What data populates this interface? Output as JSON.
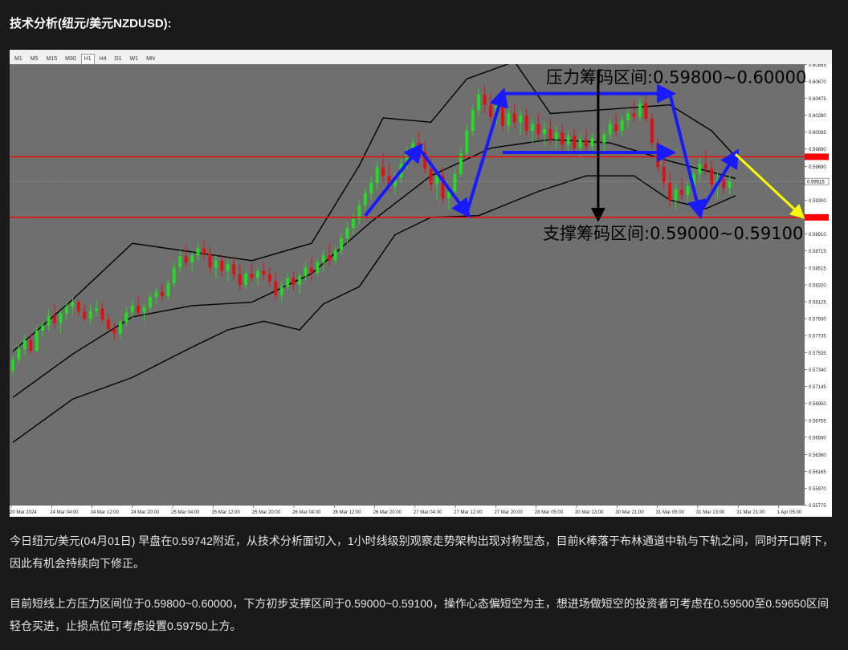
{
  "article": {
    "title": "技术分析(纽元/美元NZDUSD):",
    "paragraph1": "今日纽元/美元(04月01日) 早盘在0.59742附近，从技术分析面切入，1小时线级别观察走势架构出现对称型态，目前K棒落于布林通道中轨与下轨之间，同时开口朝下，因此有机会持续向下修正。",
    "paragraph2": "目前短线上方压力区间位于0.59800~0.60000，下方初步支撑区间于0.59000~0.59100，操作心态偏短空为主，想进场做短空的投资者可考虑在0.59500至0.59650区间轻仓买进，止损点位可考虑设置0.59750上方。"
  },
  "timeframes": [
    "M1",
    "M5",
    "M15",
    "M30",
    "H1",
    "H4",
    "D1",
    "W1",
    "MN"
  ],
  "active_timeframe": "H1",
  "chart_data": {
    "type": "candlestick",
    "symbol": "NZDUSD",
    "timeframe": "H1",
    "ylim": [
      0.5577,
      0.6087
    ],
    "y_ticks": [
      "0.60865",
      "0.60670",
      "0.60475",
      "0.60280",
      "0.60085",
      "0.59890",
      "0.59690",
      "0.59515",
      "0.59300",
      "0.59105",
      "0.58910",
      "0.58715",
      "0.58515",
      "0.58320",
      "0.58125",
      "0.57930",
      "0.57735",
      "0.57535",
      "0.57340",
      "0.57145",
      "0.56950",
      "0.56755",
      "0.56560",
      "0.56360",
      "0.56165",
      "0.55970",
      "0.55775"
    ],
    "x_ticks": [
      "20 Mar 2024",
      "24 Mar 04:00",
      "24 Mar 12:00",
      "24 Mar 20:00",
      "25 Mar 04:00",
      "25 Mar 12:00",
      "25 Mar 20:00",
      "26 Mar 04:00",
      "26 Mar 12:00",
      "26 Mar 20:00",
      "27 Mar 04:00",
      "27 Mar 12:00",
      "27 Mar 20:00",
      "28 Mar 05:00",
      "30 Mar 13:00",
      "30 Mar 21:00",
      "31 Mar 05:00",
      "31 Mar 13:00",
      "31 Mar 21:00",
      "1 Apr 05:00"
    ],
    "current_price_tag": "0.59515",
    "resistance_line": 0.598,
    "support_line": 0.591,
    "resistance_label": "压力筹码区间:0.59800~0.60000",
    "support_label": "支撑筹码区间:0.59000~0.59100",
    "colors": {
      "background": "#6f6f6f",
      "bull": "#22dd22",
      "bear": "#e01010",
      "band": "#000000",
      "level": "#ff0000",
      "pattern": "#1a1aff",
      "forecast": "#ffff00"
    },
    "candles": [
      [
        0.5733,
        0.575,
        0.5728,
        0.5746
      ],
      [
        0.5746,
        0.5764,
        0.5741,
        0.5758
      ],
      [
        0.5758,
        0.5774,
        0.5751,
        0.5768
      ],
      [
        0.5768,
        0.5775,
        0.5752,
        0.5756
      ],
      [
        0.5756,
        0.5784,
        0.5754,
        0.5779
      ],
      [
        0.5779,
        0.579,
        0.5772,
        0.5785
      ],
      [
        0.5785,
        0.5804,
        0.5779,
        0.5796
      ],
      [
        0.5796,
        0.581,
        0.5782,
        0.5788
      ],
      [
        0.5788,
        0.5802,
        0.5776,
        0.5799
      ],
      [
        0.5799,
        0.5813,
        0.579,
        0.5807
      ],
      [
        0.5807,
        0.5818,
        0.5799,
        0.5812
      ],
      [
        0.5812,
        0.5815,
        0.5796,
        0.5801
      ],
      [
        0.5801,
        0.5809,
        0.579,
        0.5793
      ],
      [
        0.5793,
        0.5809,
        0.5787,
        0.5802
      ],
      [
        0.5802,
        0.5814,
        0.5796,
        0.5805
      ],
      [
        0.5805,
        0.5811,
        0.5788,
        0.5792
      ],
      [
        0.5792,
        0.5797,
        0.5778,
        0.5781
      ],
      [
        0.5781,
        0.5788,
        0.5768,
        0.5776
      ],
      [
        0.5776,
        0.5792,
        0.577,
        0.5789
      ],
      [
        0.5789,
        0.5806,
        0.5784,
        0.58
      ],
      [
        0.58,
        0.5815,
        0.5794,
        0.5808
      ],
      [
        0.5808,
        0.582,
        0.5796,
        0.58
      ],
      [
        0.58,
        0.581,
        0.579,
        0.5806
      ],
      [
        0.5806,
        0.5822,
        0.5802,
        0.5818
      ],
      [
        0.5818,
        0.5829,
        0.581,
        0.5824
      ],
      [
        0.5824,
        0.5833,
        0.5814,
        0.5819
      ],
      [
        0.5819,
        0.5838,
        0.5815,
        0.5834
      ],
      [
        0.5834,
        0.5858,
        0.583,
        0.5852
      ],
      [
        0.5852,
        0.5872,
        0.5846,
        0.5865
      ],
      [
        0.5865,
        0.5878,
        0.5852,
        0.5858
      ],
      [
        0.5858,
        0.587,
        0.5848,
        0.5866
      ],
      [
        0.5866,
        0.588,
        0.586,
        0.5874
      ],
      [
        0.5874,
        0.5885,
        0.5862,
        0.5868
      ],
      [
        0.5868,
        0.5876,
        0.5845,
        0.5852
      ],
      [
        0.5852,
        0.5866,
        0.584,
        0.586
      ],
      [
        0.586,
        0.5868,
        0.5842,
        0.5848
      ],
      [
        0.5848,
        0.5862,
        0.5836,
        0.5856
      ],
      [
        0.5856,
        0.5865,
        0.5838,
        0.5844
      ],
      [
        0.5844,
        0.5856,
        0.5826,
        0.5832
      ],
      [
        0.5832,
        0.5848,
        0.5828,
        0.5845
      ],
      [
        0.5845,
        0.5856,
        0.5836,
        0.584
      ],
      [
        0.584,
        0.5852,
        0.5832,
        0.5848
      ],
      [
        0.5848,
        0.5858,
        0.5838,
        0.5844
      ],
      [
        0.5844,
        0.5852,
        0.583,
        0.5836
      ],
      [
        0.5836,
        0.5846,
        0.5814,
        0.582
      ],
      [
        0.582,
        0.5836,
        0.5812,
        0.583
      ],
      [
        0.583,
        0.5845,
        0.5826,
        0.584
      ],
      [
        0.584,
        0.5848,
        0.5826,
        0.5832
      ],
      [
        0.5832,
        0.5846,
        0.5822,
        0.5842
      ],
      [
        0.5842,
        0.5858,
        0.5836,
        0.5852
      ],
      [
        0.5852,
        0.5864,
        0.5838,
        0.5846
      ],
      [
        0.5846,
        0.5862,
        0.5842,
        0.5858
      ],
      [
        0.5858,
        0.5872,
        0.5848,
        0.5866
      ],
      [
        0.5866,
        0.588,
        0.5854,
        0.586
      ],
      [
        0.586,
        0.5876,
        0.5856,
        0.5872
      ],
      [
        0.5872,
        0.5892,
        0.5866,
        0.5886
      ],
      [
        0.5886,
        0.5904,
        0.588,
        0.5898
      ],
      [
        0.5898,
        0.5915,
        0.589,
        0.5908
      ],
      [
        0.5908,
        0.593,
        0.5902,
        0.5924
      ],
      [
        0.5924,
        0.5945,
        0.5918,
        0.5938
      ],
      [
        0.5938,
        0.5958,
        0.593,
        0.595
      ],
      [
        0.595,
        0.5975,
        0.5942,
        0.5968
      ],
      [
        0.5968,
        0.5984,
        0.595,
        0.5958
      ],
      [
        0.5958,
        0.5972,
        0.594,
        0.5946
      ],
      [
        0.5946,
        0.5962,
        0.5936,
        0.5956
      ],
      [
        0.5956,
        0.5978,
        0.595,
        0.5972
      ],
      [
        0.5972,
        0.5992,
        0.5966,
        0.5986
      ],
      [
        0.5986,
        0.6002,
        0.5976,
        0.5996
      ],
      [
        0.5996,
        0.601,
        0.598,
        0.5986
      ],
      [
        0.5986,
        0.5998,
        0.596,
        0.5966
      ],
      [
        0.5966,
        0.5978,
        0.594,
        0.5948
      ],
      [
        0.5948,
        0.5962,
        0.593,
        0.5958
      ],
      [
        0.5958,
        0.5968,
        0.5926,
        0.5932
      ],
      [
        0.5932,
        0.5946,
        0.5918,
        0.594
      ],
      [
        0.594,
        0.5966,
        0.5936,
        0.596
      ],
      [
        0.596,
        0.599,
        0.5956,
        0.5984
      ],
      [
        0.5984,
        0.6016,
        0.5978,
        0.601
      ],
      [
        0.601,
        0.604,
        0.6004,
        0.6034
      ],
      [
        0.6034,
        0.606,
        0.6026,
        0.6052
      ],
      [
        0.6052,
        0.6062,
        0.603,
        0.604
      ],
      [
        0.604,
        0.6054,
        0.602,
        0.6026
      ],
      [
        0.6026,
        0.6046,
        0.6018,
        0.604
      ],
      [
        0.604,
        0.605,
        0.601,
        0.6016
      ],
      [
        0.6016,
        0.6036,
        0.6008,
        0.603
      ],
      [
        0.603,
        0.6042,
        0.6014,
        0.602
      ],
      [
        0.602,
        0.6034,
        0.6006,
        0.6028
      ],
      [
        0.6028,
        0.6036,
        0.6004,
        0.601
      ],
      [
        0.601,
        0.6024,
        0.5996,
        0.6018
      ],
      [
        0.6018,
        0.603,
        0.6,
        0.6006
      ],
      [
        0.6006,
        0.602,
        0.5992,
        0.6012
      ],
      [
        0.6012,
        0.6024,
        0.5994,
        0.6
      ],
      [
        0.6,
        0.6016,
        0.599,
        0.6008
      ],
      [
        0.6008,
        0.6018,
        0.5986,
        0.5994
      ],
      [
        0.5994,
        0.601,
        0.5984,
        0.6004
      ],
      [
        0.6004,
        0.6012,
        0.5982,
        0.599
      ],
      [
        0.599,
        0.6006,
        0.598,
        0.6
      ],
      [
        0.6,
        0.6012,
        0.5984,
        0.5992
      ],
      [
        0.5992,
        0.6008,
        0.5982,
        0.6002
      ],
      [
        0.6002,
        0.6014,
        0.5988,
        0.5996
      ],
      [
        0.5996,
        0.601,
        0.5984,
        0.6006
      ],
      [
        0.6006,
        0.6024,
        0.6,
        0.6018
      ],
      [
        0.6018,
        0.603,
        0.6004,
        0.601
      ],
      [
        0.601,
        0.6028,
        0.6004,
        0.6022
      ],
      [
        0.6022,
        0.6036,
        0.6012,
        0.603
      ],
      [
        0.603,
        0.6044,
        0.602,
        0.6026
      ],
      [
        0.6026,
        0.6048,
        0.6022,
        0.6042
      ],
      [
        0.6042,
        0.6052,
        0.602,
        0.6024
      ],
      [
        0.6024,
        0.603,
        0.599,
        0.5996
      ],
      [
        0.5996,
        0.6002,
        0.5962,
        0.5968
      ],
      [
        0.5968,
        0.598,
        0.5944,
        0.595
      ],
      [
        0.595,
        0.5962,
        0.5922,
        0.593
      ],
      [
        0.593,
        0.5948,
        0.592,
        0.5942
      ],
      [
        0.5942,
        0.5956,
        0.593,
        0.5936
      ],
      [
        0.5936,
        0.5952,
        0.5928,
        0.5946
      ],
      [
        0.5946,
        0.5966,
        0.594,
        0.596
      ],
      [
        0.596,
        0.598,
        0.5952,
        0.5972
      ],
      [
        0.5972,
        0.5988,
        0.596,
        0.5966
      ],
      [
        0.5966,
        0.5976,
        0.5942,
        0.5948
      ],
      [
        0.5948,
        0.5962,
        0.5932,
        0.5954
      ],
      [
        0.5954,
        0.5964,
        0.5938,
        0.5944
      ],
      [
        0.5944,
        0.5958,
        0.5936,
        0.5952
      ]
    ],
    "bollinger": {
      "middle": [
        [
          0,
          0.5702
        ],
        [
          10,
          0.5752
        ],
        [
          20,
          0.5795
        ],
        [
          30,
          0.5808
        ],
        [
          40,
          0.5812
        ],
        [
          50,
          0.5845
        ],
        [
          60,
          0.5905
        ],
        [
          70,
          0.5958
        ],
        [
          80,
          0.599
        ],
        [
          90,
          0.6
        ],
        [
          100,
          0.5996
        ],
        [
          110,
          0.5975
        ],
        [
          121,
          0.5955
        ]
      ],
      "upper": [
        [
          0,
          0.5755
        ],
        [
          10,
          0.5815
        ],
        [
          20,
          0.588
        ],
        [
          30,
          0.587
        ],
        [
          40,
          0.586
        ],
        [
          50,
          0.588
        ],
        [
          58,
          0.597
        ],
        [
          62,
          0.6025
        ],
        [
          70,
          0.602
        ],
        [
          76,
          0.607
        ],
        [
          84,
          0.609
        ],
        [
          90,
          0.603
        ],
        [
          100,
          0.6035
        ],
        [
          110,
          0.604
        ],
        [
          117,
          0.601
        ],
        [
          121,
          0.598
        ]
      ],
      "lower": [
        [
          0,
          0.565
        ],
        [
          10,
          0.57
        ],
        [
          20,
          0.5725
        ],
        [
          30,
          0.576
        ],
        [
          36,
          0.578
        ],
        [
          42,
          0.579
        ],
        [
          48,
          0.578
        ],
        [
          52,
          0.581
        ],
        [
          58,
          0.583
        ],
        [
          64,
          0.589
        ],
        [
          70,
          0.591
        ],
        [
          78,
          0.5912
        ],
        [
          88,
          0.594
        ],
        [
          96,
          0.5958
        ],
        [
          104,
          0.5958
        ],
        [
          110,
          0.593
        ],
        [
          116,
          0.592
        ],
        [
          121,
          0.5935
        ]
      ]
    },
    "pattern_points": [
      [
        59,
        0.5912
      ],
      [
        68,
        0.599
      ],
      [
        76,
        0.5915
      ],
      [
        82,
        0.6053
      ],
      [
        110,
        0.6053
      ],
      [
        115,
        0.5915
      ],
      [
        121,
        0.5983
      ]
    ],
    "pattern_arrow_2": [
      [
        82,
        0.5985
      ],
      [
        110,
        0.5985
      ]
    ],
    "forecast_arrow": [
      [
        121,
        0.5983
      ],
      [
        132,
        0.5912
      ]
    ],
    "black_arrow_x": 98,
    "black_arrow_y": [
      0.608,
      0.591
    ]
  }
}
